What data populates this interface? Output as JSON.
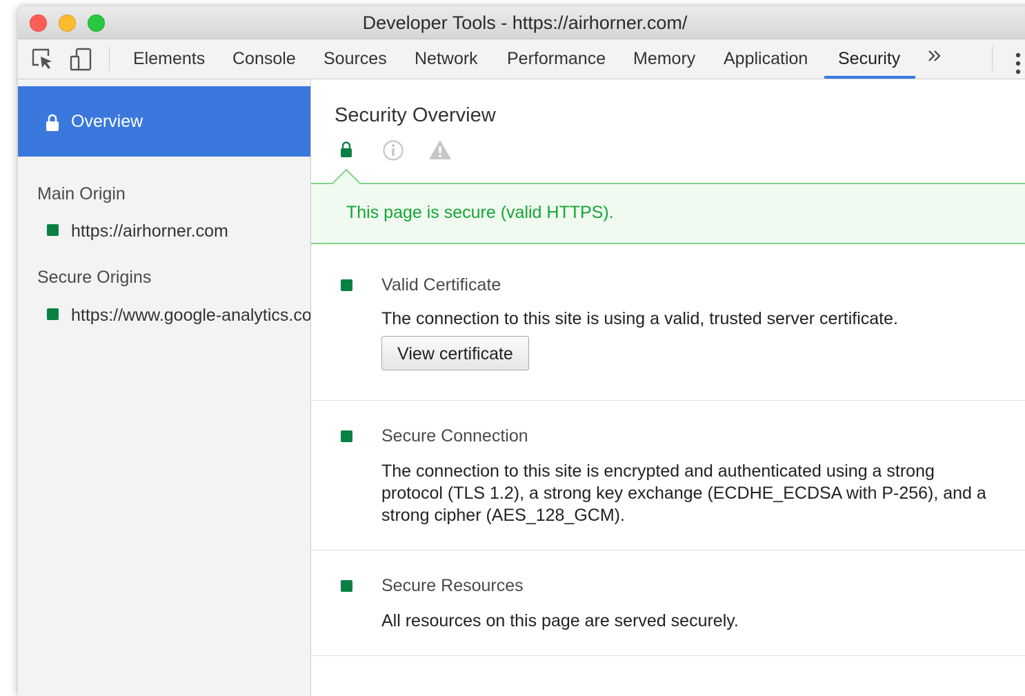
{
  "window": {
    "title": "Developer Tools - https://airhorner.com/"
  },
  "toolbar": {
    "tabs": [
      {
        "label": "Elements"
      },
      {
        "label": "Console"
      },
      {
        "label": "Sources"
      },
      {
        "label": "Network"
      },
      {
        "label": "Performance"
      },
      {
        "label": "Memory"
      },
      {
        "label": "Application"
      },
      {
        "label": "Security",
        "active": true
      }
    ],
    "icons": [
      "inspect-element-icon",
      "device-toolbar-icon",
      "more-tabs-icon",
      "kebab-menu-icon"
    ]
  },
  "sidebar": {
    "overview_label": "Overview",
    "main_origin_title": "Main Origin",
    "main_origin": "https://airhorner.com",
    "secure_origins_title": "Secure Origins",
    "secure_origins": [
      "https://www.google-analytics.com"
    ]
  },
  "main": {
    "title": "Security Overview",
    "summary_icons": [
      "lock-icon",
      "info-icon",
      "warning-icon"
    ],
    "banner_text": "This page is secure (valid HTTPS).",
    "cards": [
      {
        "title": "Valid Certificate",
        "description": "The connection to this site is using a valid, trusted server certificate.",
        "button_label": "View certificate"
      },
      {
        "title": "Secure Connection",
        "description": "The connection to this site is encrypted and authenticated using a strong protocol (TLS 1.2), a strong key exchange (ECDHE_ECDSA with P-256), and a strong cipher (AES_128_GCM)."
      },
      {
        "title": "Secure Resources",
        "description": "All resources on this page are served securely."
      }
    ]
  },
  "colors": {
    "accent": "#3b7be8",
    "secure_green": "#0b8043",
    "banner_text": "#16a538",
    "banner_bg": "#f0faf0"
  }
}
